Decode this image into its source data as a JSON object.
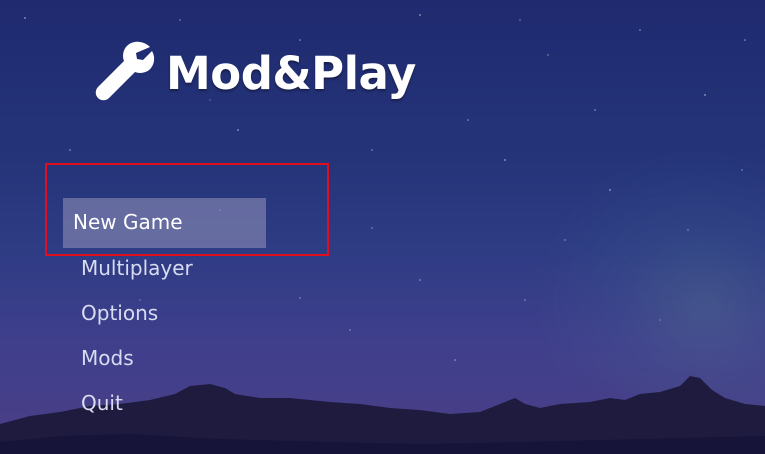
{
  "app": {
    "logo_text": "Mod&Play",
    "logo_icon": "wrench-icon"
  },
  "menu": {
    "items": [
      {
        "label": "New Game",
        "selected": true
      },
      {
        "label": "Multiplayer",
        "selected": false
      },
      {
        "label": "Options",
        "selected": false
      },
      {
        "label": "Mods",
        "selected": false
      },
      {
        "label": "Quit",
        "selected": false
      }
    ]
  },
  "colors": {
    "sky_top": "#1f2a6f",
    "sky_bottom": "#4b3f86",
    "mountains": "#1e1b3f",
    "highlight_border": "#e10f1d",
    "menu_text": "#d8dcf2",
    "selected_bg": "rgba(150,150,185,0.55)"
  }
}
